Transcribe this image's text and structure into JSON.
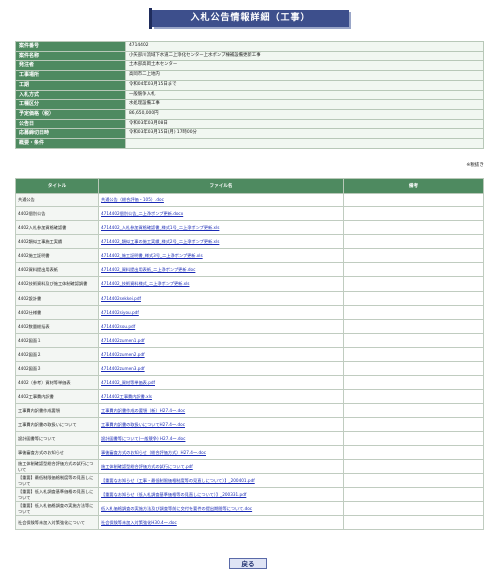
{
  "header": {
    "title": "入札公告情報詳細（工事）"
  },
  "info": [
    {
      "label": "案件番号",
      "value": "4714402"
    },
    {
      "label": "案件名称",
      "value": "小矢部川流域下水道二上浄化センター上水ポンプ棟補設備更新工事"
    },
    {
      "label": "発注者",
      "value": "土木部高岡土木センター"
    },
    {
      "label": "工事場所",
      "value": "高岡市二上地内"
    },
    {
      "label": "工期",
      "value": "令和04年03月15日まで"
    },
    {
      "label": "入札方式",
      "value": "一般競争入札"
    },
    {
      "label": "工種区分",
      "value": "水処理設備工事"
    },
    {
      "label": "予定価格（税）",
      "value": "86,650,000円"
    },
    {
      "label": "公告日",
      "value": "令和03年03月08日"
    },
    {
      "label": "応募締切日時",
      "value": "令和03年03月15日(月) 17時00分"
    },
    {
      "label": "概要・条件",
      "value": ""
    }
  ],
  "tax_note": "※税抜き",
  "files": {
    "headers": [
      "タイトル",
      "ファイル名",
      "備考"
    ],
    "rows": [
      {
        "title": "共通公告",
        "file": "共通公告（総合評価・105）.doc",
        "note": ""
      },
      {
        "title": "4402個別公告",
        "file": "4714402個別公告_二上浄ポンプ更新.docx",
        "note": ""
      },
      {
        "title": "4402入札参加資格確認書",
        "file": "4714402_入札参加資格確認書_様式1号_二上浄ポンプ更新.xls",
        "note": ""
      },
      {
        "title": "4402類似工事施工実績",
        "file": "4714402_類似工事の施工実績_様式2号_二上浄ポンプ更新.xls",
        "note": ""
      },
      {
        "title": "4402施工証明書",
        "file": "4714402_施工証明書_様式3号_二上浄ポンプ更新.xls",
        "note": ""
      },
      {
        "title": "4402資料提出用表紙",
        "file": "4714402_資料提出用表紙_二上浄ポンプ更新.doc",
        "note": ""
      },
      {
        "title": "4402技術資料及び施工体制確認調書",
        "file": "4714402_技術資料様式_二上浄ポンプ更新.xls",
        "note": ""
      },
      {
        "title": "4402設計書",
        "file": "4714402sekkei.pdf",
        "note": ""
      },
      {
        "title": "4402仕様書",
        "file": "4714402siyou.pdf",
        "note": ""
      },
      {
        "title": "4402数量総括表",
        "file": "4714402sou.pdf",
        "note": ""
      },
      {
        "title": "4402図面１",
        "file": "4714402zumen1.pdf",
        "note": ""
      },
      {
        "title": "4402図面２",
        "file": "4714402zumen2.pdf",
        "note": ""
      },
      {
        "title": "4402図面３",
        "file": "4714402zumen3.pdf",
        "note": ""
      },
      {
        "title": "4402（参考）資材等単価表",
        "file": "4714402_資材等単価表.pdf",
        "note": ""
      },
      {
        "title": "4402工事費内訳書",
        "file": "4714402工事費内訳書.xls",
        "note": ""
      },
      {
        "title": "工事費内訳書作成要領",
        "file": "工事費内訳書作成の要領（新）H27.4〜.doc",
        "note": ""
      },
      {
        "title": "工事費内訳書の取扱いについて",
        "file": "工事費内訳書の取扱いについてH27.4〜.doc",
        "note": ""
      },
      {
        "title": "設計図書等について",
        "file": "設計図書等について(一般競争) H27.4〜.doc",
        "note": ""
      },
      {
        "title": "事後審査方式のお知らせ",
        "file": "事後審査方式のお知らせ（総合評価方式）H27.4〜.doc",
        "note": ""
      },
      {
        "title": "施工体制確認型総合評価方式の試行について",
        "file": "施工体制確認型総合評価方式の試行について.pdf",
        "note": ""
      },
      {
        "title": "【重要】最低制限価格制度等の見直しについて",
        "file": "【重要なお知らせ（工事・最低制限価格制度等の見直しについて）】_200401.pdf",
        "note": ""
      },
      {
        "title": "【重要】低入札調査基準価格の見直しについて",
        "file": "【重要なお知らせ（低入札調査基準価格等の見直しについて）】_200331.pdf",
        "note": ""
      },
      {
        "title": "【重要】低入札価格調査の実施方法等について",
        "file": "低入札価格調査の実施方法及び調査等前に交付を要件の提出期間等について.doc",
        "note": ""
      },
      {
        "title": "社会保険等未加入対策強化について",
        "file": "社会保険等未加入対策強化H30.4〜.doc",
        "note": ""
      }
    ]
  },
  "footer": {
    "back_label": "戻る"
  }
}
